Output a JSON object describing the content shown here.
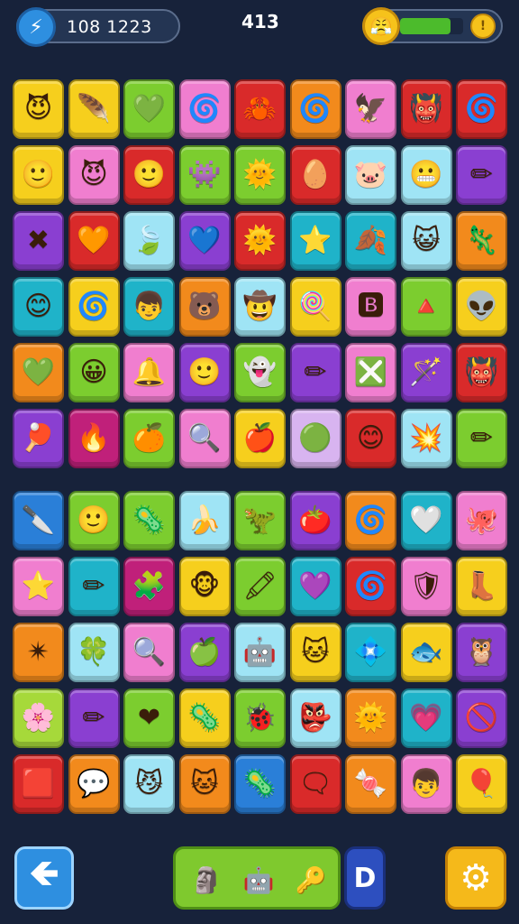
{
  "header": {
    "score_text": "108 1223",
    "score_icon": "lightning-icon",
    "moves_text": "413",
    "energy_icon": "face-icon",
    "energy_level": 0.8,
    "coin_icon": "coin-icon"
  },
  "colors": {
    "yellow": "#f6cf1d",
    "green": "#7ccd2f",
    "pink": "#f07ecf",
    "red": "#d92a2a",
    "orange": "#f28a1c",
    "purple": "#8a3fd1",
    "teal": "#1fb3c9",
    "sky": "#9fe4f5",
    "blue": "#2a7fd8",
    "magenta": "#c0207a",
    "lavender": "#d8b4f0",
    "lime": "#a6d93a"
  },
  "boards": [
    {
      "name": "upper-board",
      "rows": [
        [
          {
            "color": "yellow",
            "icon": "horned-face-icon",
            "glyph": "😈"
          },
          {
            "color": "yellow",
            "icon": "feather-icon",
            "glyph": "🪶"
          },
          {
            "color": "green",
            "icon": "heart-icon",
            "glyph": "💚"
          },
          {
            "color": "pink",
            "icon": "spiral-icon",
            "glyph": "🌀"
          },
          {
            "color": "red",
            "icon": "crab-icon",
            "glyph": "🦀"
          },
          {
            "color": "orange",
            "icon": "spiral-icon",
            "glyph": "🌀"
          },
          {
            "color": "pink",
            "icon": "bird-icon",
            "glyph": "🦅"
          },
          {
            "color": "red",
            "icon": "tiki-icon",
            "glyph": "👹"
          },
          {
            "color": "red",
            "icon": "spiral-icon",
            "glyph": "🌀"
          }
        ],
        [
          {
            "color": "yellow",
            "icon": "face-icon",
            "glyph": "🙂"
          },
          {
            "color": "pink",
            "icon": "horned-face-icon",
            "glyph": "😈"
          },
          {
            "color": "red",
            "icon": "face-icon",
            "glyph": "🙂"
          },
          {
            "color": "green",
            "icon": "ghost-icon",
            "glyph": "👾"
          },
          {
            "color": "green",
            "icon": "sun-face-icon",
            "glyph": "🌞"
          },
          {
            "color": "red",
            "icon": "egg-face-icon",
            "glyph": "🥚"
          },
          {
            "color": "sky",
            "icon": "pig-icon",
            "glyph": "🐷"
          },
          {
            "color": "sky",
            "icon": "helmet-face-icon",
            "glyph": "😬"
          },
          {
            "color": "purple",
            "icon": "pencil-icon",
            "glyph": "✏"
          }
        ],
        [
          {
            "color": "purple",
            "icon": "cross-icon",
            "glyph": "✖"
          },
          {
            "color": "red",
            "icon": "heart-icon",
            "glyph": "🧡"
          },
          {
            "color": "sky",
            "icon": "leaf-icon",
            "glyph": "🍃"
          },
          {
            "color": "purple",
            "icon": "heart-icon",
            "glyph": "💙"
          },
          {
            "color": "red",
            "icon": "sun-face-icon",
            "glyph": "🌞"
          },
          {
            "color": "teal",
            "icon": "star-icon",
            "glyph": "⭐"
          },
          {
            "color": "teal",
            "icon": "leaf-icon",
            "glyph": "🍂"
          },
          {
            "color": "sky",
            "icon": "cat-face-icon",
            "glyph": "😺"
          },
          {
            "color": "orange",
            "icon": "lizard-icon",
            "glyph": "🦎"
          }
        ],
        [
          {
            "color": "teal",
            "icon": "smile-icon",
            "glyph": "😊"
          },
          {
            "color": "yellow",
            "icon": "spiral-icon",
            "glyph": "🌀"
          },
          {
            "color": "teal",
            "icon": "boy-face-icon",
            "glyph": "👦"
          },
          {
            "color": "orange",
            "icon": "bear-icon",
            "glyph": "🐻"
          },
          {
            "color": "sky",
            "icon": "cowboy-face-icon",
            "glyph": "🤠"
          },
          {
            "color": "yellow",
            "icon": "lollipop-icon",
            "glyph": "🍭"
          },
          {
            "color": "pink",
            "icon": "letter-b-icon",
            "glyph": "🅱"
          },
          {
            "color": "green",
            "icon": "triangle-icon",
            "glyph": "🔺"
          },
          {
            "color": "yellow",
            "icon": "alien-icon",
            "glyph": "👽"
          }
        ],
        [
          {
            "color": "orange",
            "icon": "heart-icon",
            "glyph": "💚"
          },
          {
            "color": "green",
            "icon": "smile-icon",
            "glyph": "😀"
          },
          {
            "color": "pink",
            "icon": "bell-icon",
            "glyph": "🔔"
          },
          {
            "color": "purple",
            "icon": "face-icon",
            "glyph": "🙂"
          },
          {
            "color": "green",
            "icon": "ghost-face-icon",
            "glyph": "👻"
          },
          {
            "color": "purple",
            "icon": "pencil-icon",
            "glyph": "✏"
          },
          {
            "color": "pink",
            "icon": "cross-icon",
            "glyph": "❎"
          },
          {
            "color": "purple",
            "icon": "wand-icon",
            "glyph": "🪄"
          },
          {
            "color": "red",
            "icon": "devil-icon",
            "glyph": "👹"
          }
        ],
        [
          {
            "color": "purple",
            "icon": "paddle-icon",
            "glyph": "🏓"
          },
          {
            "color": "magenta",
            "icon": "flame-icon",
            "glyph": "🔥"
          },
          {
            "color": "green",
            "icon": "fruit-icon",
            "glyph": "🍊"
          },
          {
            "color": "pink",
            "icon": "magnifier-icon",
            "glyph": "🔍"
          },
          {
            "color": "yellow",
            "icon": "apple-icon",
            "glyph": "🍎"
          },
          {
            "color": "lavender",
            "icon": "smile-icon",
            "glyph": "🟢"
          },
          {
            "color": "red",
            "icon": "smile-icon",
            "glyph": "😊"
          },
          {
            "color": "sky",
            "icon": "splat-icon",
            "glyph": "💥"
          },
          {
            "color": "green",
            "icon": "pencil-icon",
            "glyph": "✏"
          }
        ]
      ]
    },
    {
      "name": "lower-board",
      "rows": [
        [
          {
            "color": "blue",
            "icon": "knife-icon",
            "glyph": "🔪"
          },
          {
            "color": "green",
            "icon": "face-icon",
            "glyph": "🙂"
          },
          {
            "color": "green",
            "icon": "virus-face-icon",
            "glyph": "🦠"
          },
          {
            "color": "sky",
            "icon": "banana-icon",
            "glyph": "🍌"
          },
          {
            "color": "green",
            "icon": "dino-icon",
            "glyph": "🦖"
          },
          {
            "color": "purple",
            "icon": "tomato-icon",
            "glyph": "🍅"
          },
          {
            "color": "orange",
            "icon": "spiral-icon",
            "glyph": "🌀"
          },
          {
            "color": "teal",
            "icon": "heart-icon",
            "glyph": "🤍"
          },
          {
            "color": "pink",
            "icon": "octopus-icon",
            "glyph": "🐙"
          }
        ],
        [
          {
            "color": "pink",
            "icon": "star-icon",
            "glyph": "⭐"
          },
          {
            "color": "teal",
            "icon": "pencil-icon",
            "glyph": "✏"
          },
          {
            "color": "magenta",
            "icon": "puzzle-icon",
            "glyph": "🧩"
          },
          {
            "color": "yellow",
            "icon": "monkey-icon",
            "glyph": "🐵"
          },
          {
            "color": "green",
            "icon": "pencil-icon",
            "glyph": "🖍"
          },
          {
            "color": "teal",
            "icon": "heart-icon",
            "glyph": "💜"
          },
          {
            "color": "red",
            "icon": "spiral-icon",
            "glyph": "🌀"
          },
          {
            "color": "pink",
            "icon": "shield-icon",
            "glyph": "🛡"
          },
          {
            "color": "yellow",
            "icon": "boot-icon",
            "glyph": "👢"
          }
        ],
        [
          {
            "color": "orange",
            "icon": "burst-icon",
            "glyph": "✴"
          },
          {
            "color": "sky",
            "icon": "clover-icon",
            "glyph": "🍀"
          },
          {
            "color": "pink",
            "icon": "magnifier-icon",
            "glyph": "🔍"
          },
          {
            "color": "purple",
            "icon": "apple-icon",
            "glyph": "🍏"
          },
          {
            "color": "sky",
            "icon": "robot-face-icon",
            "glyph": "🤖"
          },
          {
            "color": "yellow",
            "icon": "cat-face-icon",
            "glyph": "🐱"
          },
          {
            "color": "teal",
            "icon": "gem-icon",
            "glyph": "💠"
          },
          {
            "color": "yellow",
            "icon": "fish-icon",
            "glyph": "🐟"
          },
          {
            "color": "purple",
            "icon": "owl-icon",
            "glyph": "🦉"
          }
        ],
        [
          {
            "color": "lime",
            "icon": "flower-icon",
            "glyph": "🌸"
          },
          {
            "color": "purple",
            "icon": "pencil-icon",
            "glyph": "✏"
          },
          {
            "color": "green",
            "icon": "heart-icon",
            "glyph": "❤"
          },
          {
            "color": "yellow",
            "icon": "virus-icon",
            "glyph": "🦠"
          },
          {
            "color": "green",
            "icon": "ladybug-icon",
            "glyph": "🐞"
          },
          {
            "color": "sky",
            "icon": "goblin-face-icon",
            "glyph": "👺"
          },
          {
            "color": "orange",
            "icon": "sun-face-icon",
            "glyph": "🌞"
          },
          {
            "color": "teal",
            "icon": "heart-icon",
            "glyph": "💗"
          },
          {
            "color": "purple",
            "icon": "no-entry-icon",
            "glyph": "🚫"
          }
        ],
        [
          {
            "color": "red",
            "icon": "square-icon",
            "glyph": "🟥"
          },
          {
            "color": "orange",
            "icon": "dots-icon",
            "glyph": "💬"
          },
          {
            "color": "sky",
            "icon": "cat-face-icon",
            "glyph": "😼"
          },
          {
            "color": "orange",
            "icon": "cat-face-icon",
            "glyph": "🐱"
          },
          {
            "color": "blue",
            "icon": "virus-face-icon",
            "glyph": "🦠"
          },
          {
            "color": "red",
            "icon": "speech-bubble-icon",
            "glyph": "🗨"
          },
          {
            "color": "orange",
            "icon": "candy-icon",
            "glyph": "🍬"
          },
          {
            "color": "pink",
            "icon": "boy-face-icon",
            "glyph": "👦"
          },
          {
            "color": "yellow",
            "icon": "balloon-icon",
            "glyph": "🎈"
          }
        ]
      ]
    }
  ],
  "footer": {
    "back_icon": "back-arrow-icon",
    "back_glyph": "🡸",
    "powerups": [
      {
        "icon": "face-powerup-icon",
        "glyph": "🗿"
      },
      {
        "icon": "robot-powerup-icon",
        "glyph": "🤖"
      },
      {
        "icon": "key-powerup-icon",
        "glyph": "🔑"
      }
    ],
    "extra_glyph": "D",
    "settings_icon": "gear-icon",
    "settings_glyph": "⚙"
  }
}
